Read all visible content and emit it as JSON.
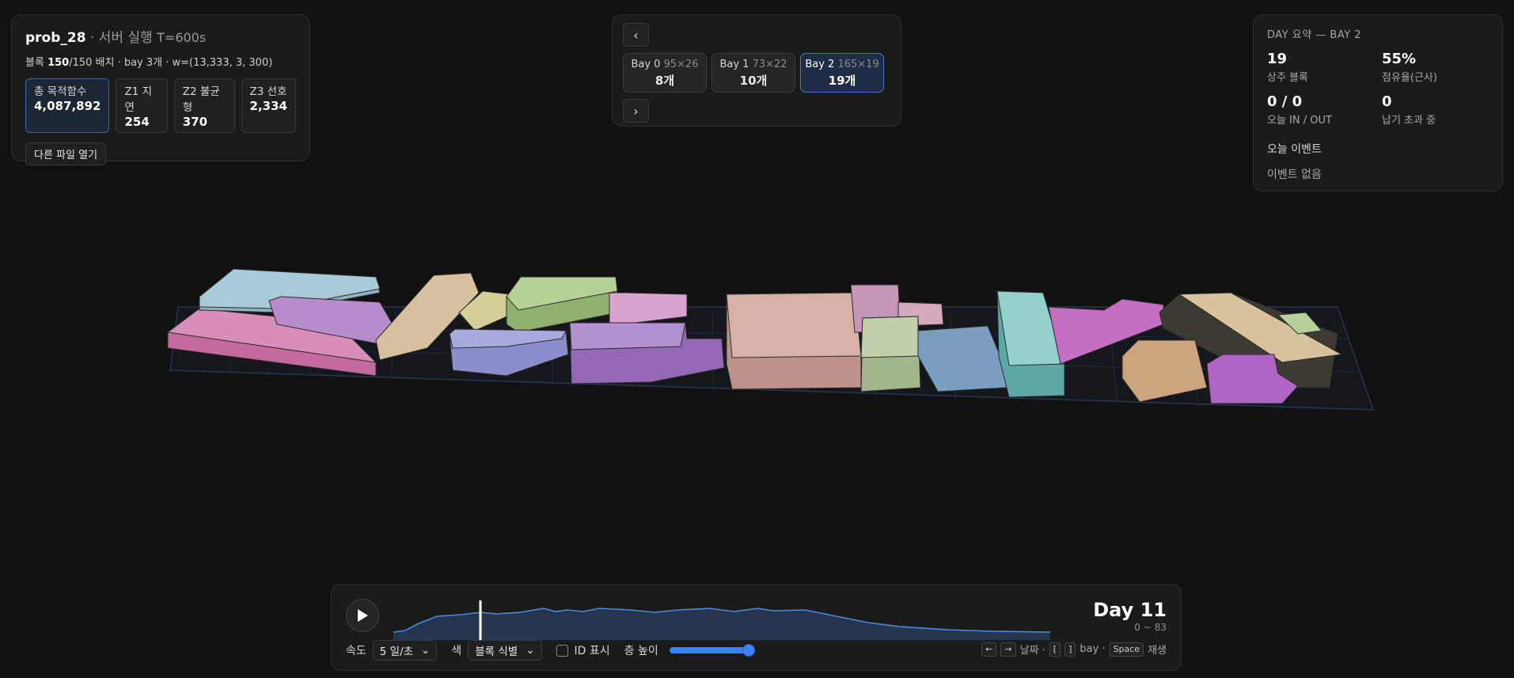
{
  "info": {
    "problem": "prob_28",
    "run_label": "서버 실행",
    "time_limit": "T=600s",
    "blocks_label": "블록",
    "blocks_placed": "150",
    "blocks_total": "/150 배치 · bay 3개 · w=(13,333, 3, 300)",
    "stats": [
      {
        "label": "총 목적함수",
        "value": "4,087,892"
      },
      {
        "label": "Z1 지연",
        "value": "254"
      },
      {
        "label": "Z2 불균형",
        "value": "370"
      },
      {
        "label": "Z3 선호",
        "value": "2,334"
      }
    ],
    "open_file_button": "다른 파일 열기"
  },
  "bay_selector": {
    "prev": "‹",
    "next": "›",
    "bays": [
      {
        "name": "Bay 0",
        "dims": "95×26",
        "count": "8개",
        "selected": false
      },
      {
        "name": "Bay 1",
        "dims": "73×22",
        "count": "10개",
        "selected": false
      },
      {
        "name": "Bay 2",
        "dims": "165×19",
        "count": "19개",
        "selected": true
      }
    ]
  },
  "summary": {
    "title": "DAY 요약 — BAY 2",
    "resident_value": "19",
    "resident_label": "상주 블록",
    "occupancy_value": "55%",
    "occupancy_label": "점유율(근사)",
    "inout_value": "0 / 0",
    "inout_label": "오늘 IN / OUT",
    "overdue_value": "0",
    "overdue_label": "납기 초과 중",
    "events_heading": "오늘 이벤트",
    "events_empty": "이벤트 없음"
  },
  "timeline": {
    "day_label": "Day 11",
    "day_range": "0 ~ 83",
    "current_day": 11,
    "max_day": 83,
    "speed_label": "속도",
    "speed_value": "5 일/초",
    "color_label": "색",
    "color_value": "블록 식별",
    "id_label": "ID 표시",
    "height_label": "층 높이",
    "height_fraction": 1.0,
    "keys": {
      "left": "←",
      "right": "→",
      "day_text": "날짜 ·",
      "bracket_open": "[",
      "bracket_close": "]",
      "bay_text": "bay ·",
      "space": "Space",
      "play_text": "재생"
    },
    "accent": "#3b82f6"
  }
}
